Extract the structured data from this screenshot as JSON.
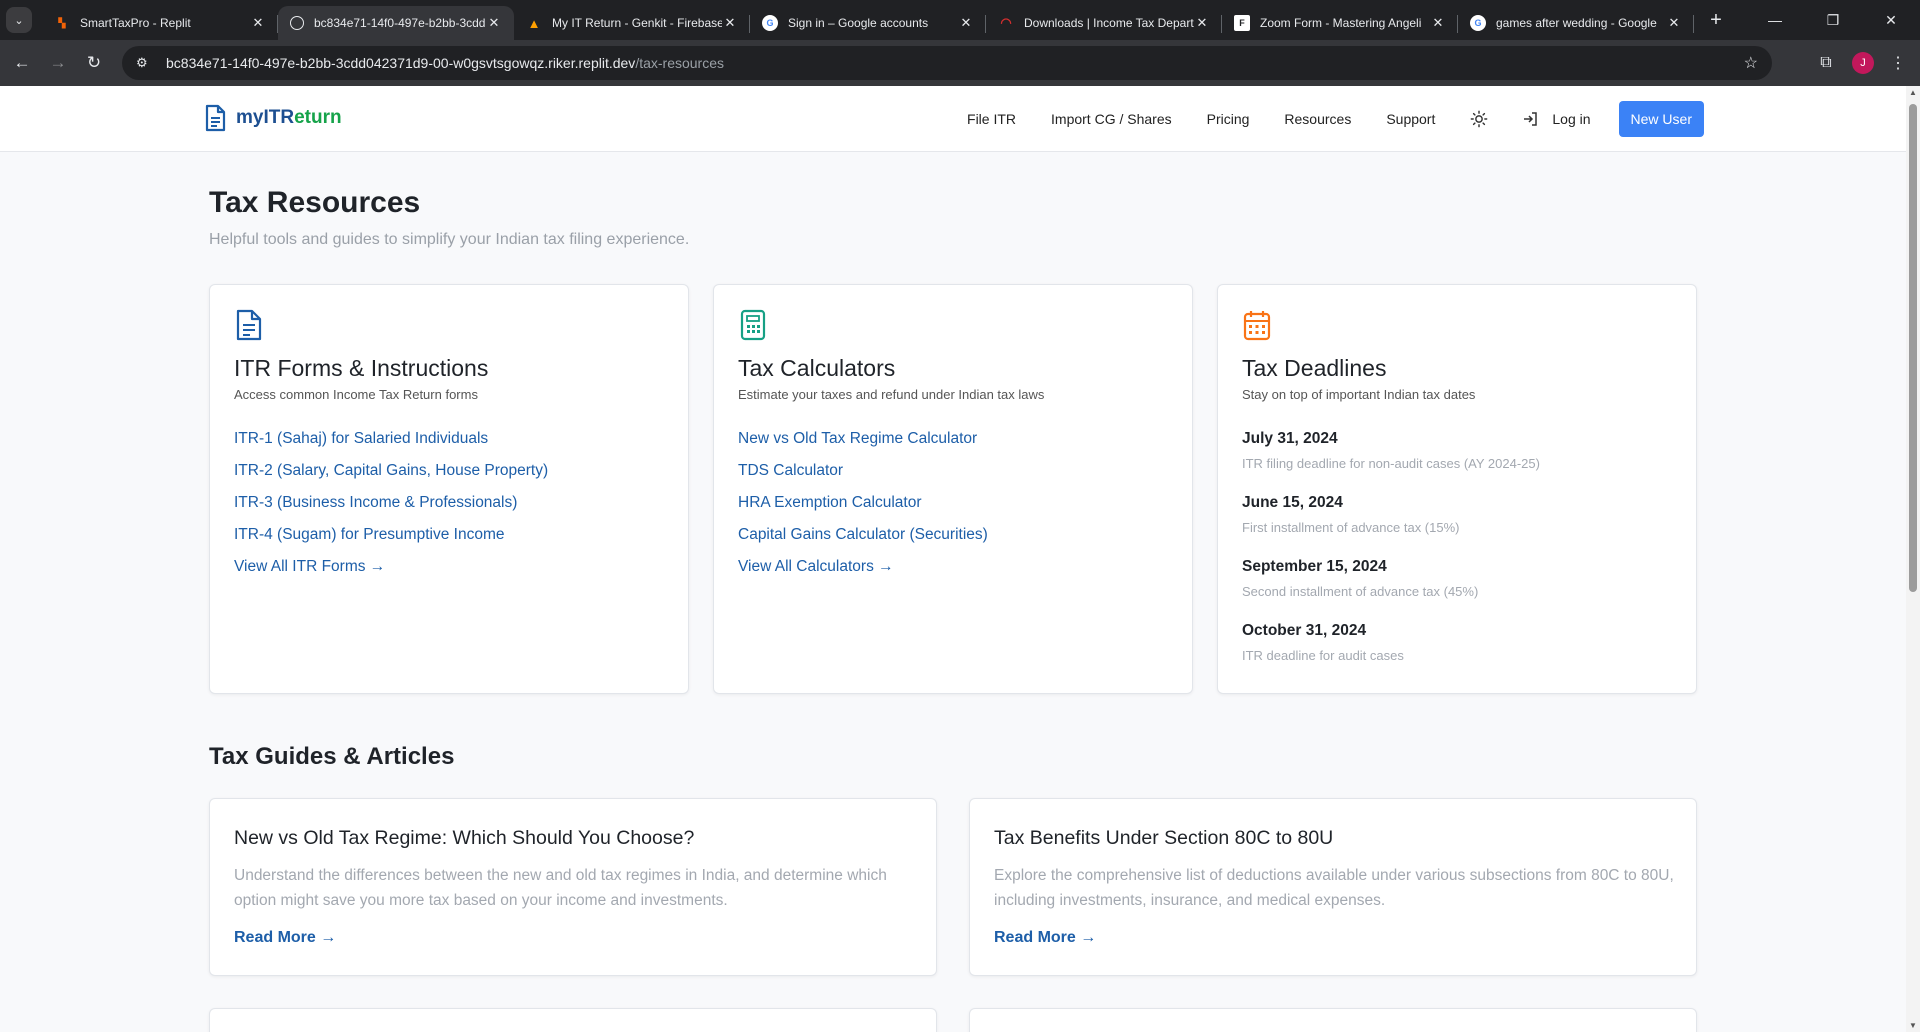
{
  "browser": {
    "tabs": [
      {
        "title": "SmartTaxPro - Replit",
        "favicon": "replit-icon",
        "color": "#f26207"
      },
      {
        "title": "bc834e71-14f0-497e-b2bb-3cdd",
        "favicon": "globe-icon",
        "color": "#9aa0a6"
      },
      {
        "title": "My IT Return - Genkit - Firebase",
        "favicon": "firebase-icon",
        "color": "#ffa000"
      },
      {
        "title": "Sign in – Google accounts",
        "favicon": "google-icon",
        "color": "#4285f4"
      },
      {
        "title": "Downloads | Income Tax Depart",
        "favicon": "incometax-icon",
        "color": "#d32f2f"
      },
      {
        "title": "Zoom Form - Mastering Angeli",
        "favicon": "form-icon",
        "color": "#ffffff"
      },
      {
        "title": "games after wedding - Google",
        "favicon": "google-icon",
        "color": "#4285f4"
      }
    ],
    "url_host": "bc834e71-14f0-497e-b2bb-3cdd042371d9-00-w0gsvtsgowqz.riker.replit.dev",
    "url_path": "/tax-resources",
    "profile_initial": "J"
  },
  "header": {
    "logo_text_a": "myITR",
    "logo_text_b": "eturn",
    "nav": [
      "File ITR",
      "Import CG / Shares",
      "Pricing",
      "Resources",
      "Support"
    ],
    "login": "Log in",
    "new_user": "New User"
  },
  "page": {
    "title": "Tax Resources",
    "subtitle": "Helpful tools and guides to simplify your Indian tax filing experience."
  },
  "cards": {
    "forms": {
      "title": "ITR Forms & Instructions",
      "desc": "Access common Income Tax Return forms",
      "links": [
        "ITR-1 (Sahaj) for Salaried Individuals",
        "ITR-2 (Salary, Capital Gains, House Property)",
        "ITR-3 (Business Income & Professionals)",
        "ITR-4 (Sugam) for Presumptive Income",
        "View All ITR Forms →"
      ]
    },
    "calculators": {
      "title": "Tax Calculators",
      "desc": "Estimate your taxes and refund under Indian tax laws",
      "links": [
        "New vs Old Tax Regime Calculator",
        "TDS Calculator",
        "HRA Exemption Calculator",
        "Capital Gains Calculator (Securities)",
        "View All Calculators →"
      ]
    },
    "deadlines": {
      "title": "Tax Deadlines",
      "desc": "Stay on top of important Indian tax dates",
      "items": [
        {
          "date": "July 31, 2024",
          "text": "ITR filing deadline for non-audit cases (AY 2024-25)"
        },
        {
          "date": "June 15, 2024",
          "text": "First installment of advance tax (15%)"
        },
        {
          "date": "September 15, 2024",
          "text": "Second installment of advance tax (45%)"
        },
        {
          "date": "October 31, 2024",
          "text": "ITR deadline for audit cases"
        }
      ]
    }
  },
  "guides": {
    "title": "Tax Guides & Articles",
    "articles": [
      {
        "title": "New vs Old Tax Regime: Which Should You Choose?",
        "excerpt": "Understand the differences between the new and old tax regimes in India, and determine which option might save you more tax based on your income and investments.",
        "cta": "Read More →"
      },
      {
        "title": "Tax Benefits Under Section 80C to 80U",
        "excerpt": "Explore the comprehensive list of deductions available under various subsections from 80C to 80U, including investments, insurance, and medical expenses.",
        "cta": "Read More →"
      }
    ]
  },
  "colors": {
    "brand_blue": "#1d4f91",
    "brand_green": "#16a34a",
    "link": "#1d5ea8",
    "primary_button": "#3b82f6",
    "forms_icon": "#1d5ea8",
    "calculator_icon": "#16a085",
    "calendar_icon": "#f97316"
  }
}
